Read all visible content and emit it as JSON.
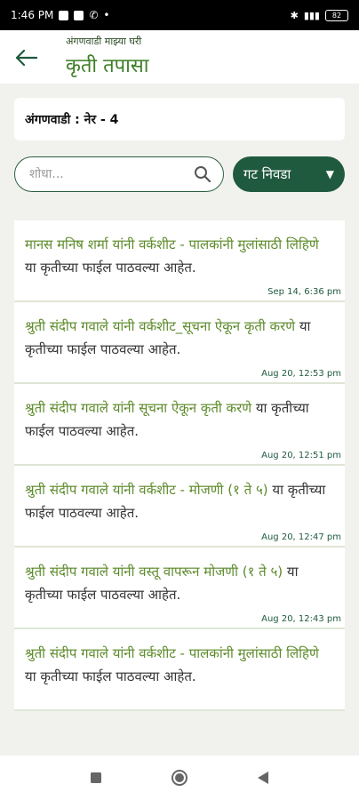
{
  "status": {
    "time": "1:46 PM",
    "battery": "82"
  },
  "header": {
    "subtitle": "अंगणवाडी माझ्या घरी",
    "title": "कृती तपासा"
  },
  "anganwadi": {
    "label": "अंगणवाडी : नेर - 4"
  },
  "search": {
    "placeholder": "शोधा..."
  },
  "group_select": {
    "label": "गट निवडा"
  },
  "items": [
    {
      "highlight": "मानस मनिष शर्मा यांनी वर्कशीट - पालकांनी मुलांसाठी लिहिणे",
      "rest": " या कृतीच्या फाईल पाठवल्या आहेत.",
      "time": "Sep 14, 6:36 pm"
    },
    {
      "highlight": "श्रुती संदीप गवाले यांनी वर्कशीट_सूचना ऐकून कृती करणे",
      "rest": " या कृतीच्या फाईल पाठवल्या आहेत.",
      "time": "Aug 20, 12:53 pm"
    },
    {
      "highlight": "श्रुती संदीप गवाले यांनी सूचना ऐकून कृती करणे",
      "rest": " या कृतीच्या फाईल पाठवल्या आहेत.",
      "time": "Aug 20, 12:51 pm"
    },
    {
      "highlight": "श्रुती संदीप गवाले यांनी वर्कशीट - मोजणी (१ ते ५)",
      "rest": " या कृतीच्या फाईल पाठवल्या आहेत.",
      "time": "Aug 20, 12:47 pm"
    },
    {
      "highlight": "श्रुती संदीप गवाले यांनी वस्तू वापरून मोजणी (१ ते ५)",
      "rest": " या कृतीच्या फाईल पाठवल्या आहेत.",
      "time": "Aug 20, 12:43 pm"
    },
    {
      "highlight": "श्रुती संदीप गवाले यांनी वर्कशीट - पालकांनी मुलांसाठी लिहिणे",
      "rest": " या कृतीच्या फाईल पाठवल्या आहेत.",
      "time": ""
    }
  ],
  "colors": {
    "accent": "#3c7d24",
    "primary": "#1f5a3e"
  }
}
